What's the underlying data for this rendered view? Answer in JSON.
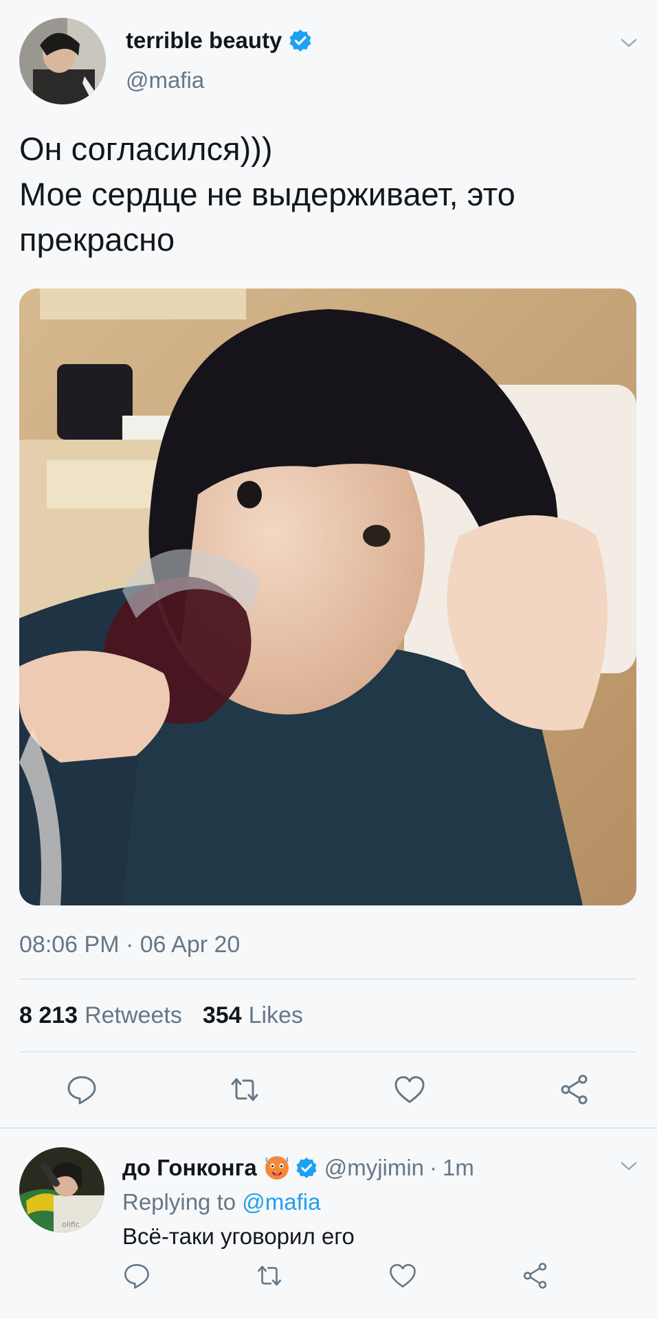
{
  "tweet": {
    "display_name": "terrible beauty",
    "handle": "@mafia",
    "text_lines": [
      "Он согласился)))",
      "Мое сердце не выдерживает, это",
      "прекрасно"
    ],
    "time": "08:06 PM",
    "date_sep": "·",
    "date": "06 Apr 20",
    "retweets_count": "8 213",
    "retweets_label": "Retweets",
    "likes_count": "354",
    "likes_label": "Likes"
  },
  "actions": [
    "reply-icon",
    "retweet-icon",
    "like-icon",
    "share-icon"
  ],
  "reply": {
    "display_name": "до Гонконга",
    "emoji": "hot-face-emoji",
    "handle": "@myjimin",
    "dot": "·",
    "time": "1m",
    "replying_prefix": "Replying to",
    "replying_to": "@mafia",
    "text": "Всё-таки уговорил его"
  },
  "colors": {
    "accent": "#1da1f2",
    "secondary_text": "#657786",
    "primary_text": "#14171a",
    "divider": "#e1e6ea",
    "background": "#f7f8fa"
  }
}
